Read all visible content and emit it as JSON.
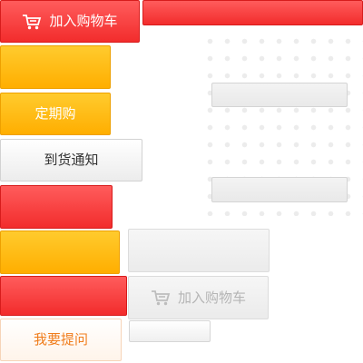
{
  "buttons": {
    "add_to_cart_primary": "加入购物车",
    "subscribe": "定期购",
    "arrival_notice": "到货通知",
    "add_to_cart_disabled": "加入购物车",
    "ask_question": "我要提问"
  },
  "icons": {
    "cart": "shopping-cart-icon"
  },
  "colors": {
    "red": "#f22c2c",
    "yellow": "#ffae00",
    "orange_text": "#f07d1c",
    "disabled_text": "#b5b5b5"
  }
}
